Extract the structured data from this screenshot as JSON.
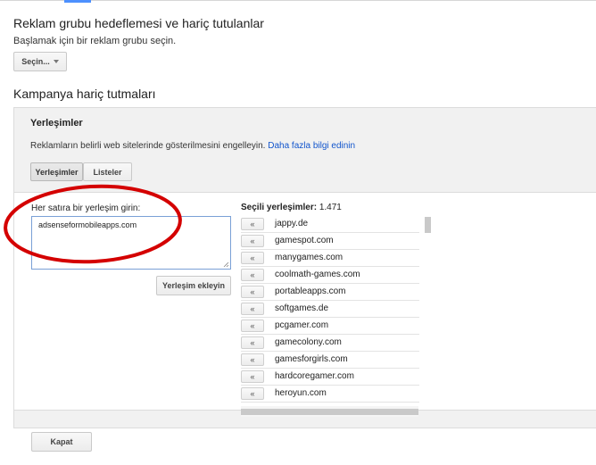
{
  "ad_group_section": {
    "title": "Reklam grubu hedeflemesi ve hariç tutulanlar",
    "subtitle": "Başlamak için bir reklam grubu seçin.",
    "select_label": "Seçin..."
  },
  "campaign_section": {
    "title": "Kampanya hariç tutmaları"
  },
  "panel": {
    "heading": "Yerleşimler",
    "description": "Reklamların belirli web sitelerinde gösterilmesini engelleyin.",
    "learn_more": "Daha fazla bilgi edinin",
    "tabs": [
      {
        "label": "Yerleşimler",
        "active": true
      },
      {
        "label": "Listeler",
        "active": false
      }
    ],
    "input_label": "Her satıra bir yerleşim girin:",
    "input_value": "adsenseformobileapps.com",
    "add_button": "Yerleşim ekleyin",
    "selected_label": "Seçili yerleşimler:",
    "selected_count": "1.471",
    "move_glyph": "«",
    "placements": [
      "jappy.de",
      "gamespot.com",
      "manygames.com",
      "coolmath-games.com",
      "portableapps.com",
      "softgames.de",
      "pcgamer.com",
      "gamecolony.com",
      "gamesforgirls.com",
      "hardcoregamer.com",
      "heroyun.com"
    ]
  },
  "close_button": "Kapat",
  "colors": {
    "accent_blue": "#4d90fe",
    "link": "#1155cc",
    "annotation_red": "#d40000",
    "panel_bg": "#f1f1f1"
  }
}
